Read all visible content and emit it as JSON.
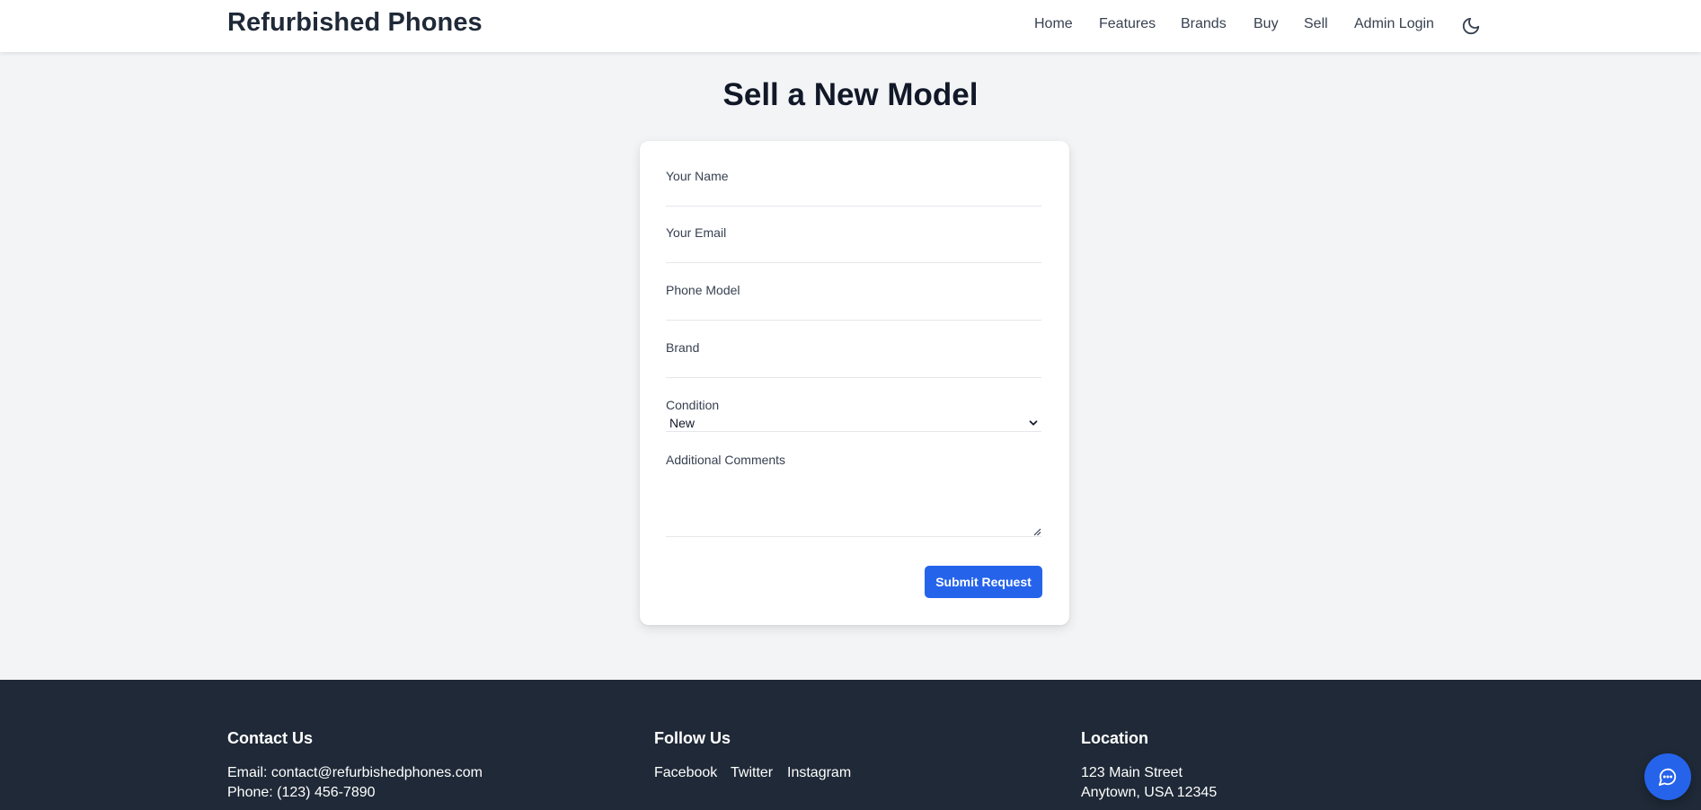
{
  "header": {
    "brand": "Refurbished Phones",
    "nav": [
      "Home",
      "Features",
      "Brands",
      "Buy",
      "Sell",
      "Admin Login"
    ],
    "theme_toggle_icon": "moon-icon"
  },
  "main": {
    "title": "Sell a New Model",
    "form": {
      "name_label": "Your Name",
      "email_label": "Your Email",
      "model_label": "Phone Model",
      "brand_label": "Brand",
      "condition_label": "Condition",
      "condition_value": "New",
      "comments_label": "Additional Comments",
      "submit_label": "Submit Request"
    }
  },
  "footer": {
    "contact": {
      "heading": "Contact Us",
      "email": "Email: contact@refurbishedphones.com",
      "phone": "Phone: (123) 456-7890"
    },
    "follow": {
      "heading": "Follow Us",
      "links": [
        "Facebook",
        "Twitter",
        "Instagram"
      ]
    },
    "location": {
      "heading": "Location",
      "line1": "123 Main Street",
      "line2": "Anytown, USA 12345"
    }
  },
  "chat_icon": "chat-bubble-icon",
  "colors": {
    "accent": "#2563eb",
    "footer_bg": "#1f2937",
    "page_bg": "#f3f4f6"
  }
}
